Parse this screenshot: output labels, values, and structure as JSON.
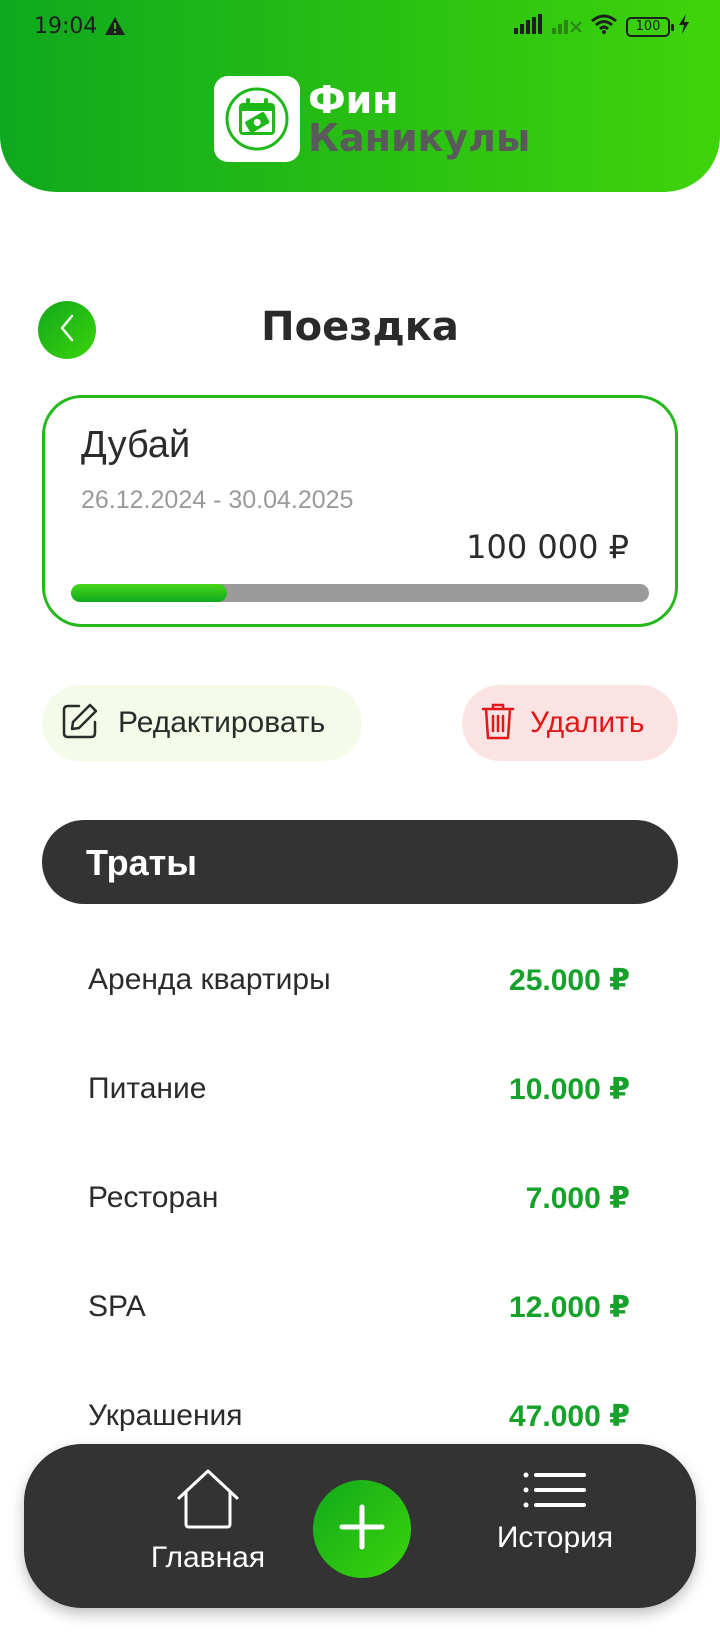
{
  "status": {
    "time": "19:04",
    "battery": "100"
  },
  "app": {
    "logo_line1": "Фин",
    "logo_line2": "Каникулы"
  },
  "page": {
    "title": "Поездка"
  },
  "trip": {
    "name": "Дубай",
    "dates": "26.12.2024 - 30.04.2025",
    "budget": "100 000 ₽",
    "progress_fraction": 0.27
  },
  "actions": {
    "edit_label": "Редактировать",
    "delete_label": "Удалить"
  },
  "expenses": {
    "title": "Траты",
    "items": [
      {
        "name": "Аренда квартиры",
        "amount": "25.000 ₽"
      },
      {
        "name": "Питание",
        "amount": "10.000 ₽"
      },
      {
        "name": "Ресторан",
        "amount": "7.000 ₽"
      },
      {
        "name": "SPA",
        "amount": "12.000 ₽"
      },
      {
        "name": "Украшения",
        "amount": "47.000 ₽"
      }
    ]
  },
  "nav": {
    "home_label": "Главная",
    "history_label": "История"
  },
  "colors": {
    "accent": "#1fb81a",
    "dark": "#333333",
    "delete": "#e01818",
    "amount": "#15a12a"
  }
}
